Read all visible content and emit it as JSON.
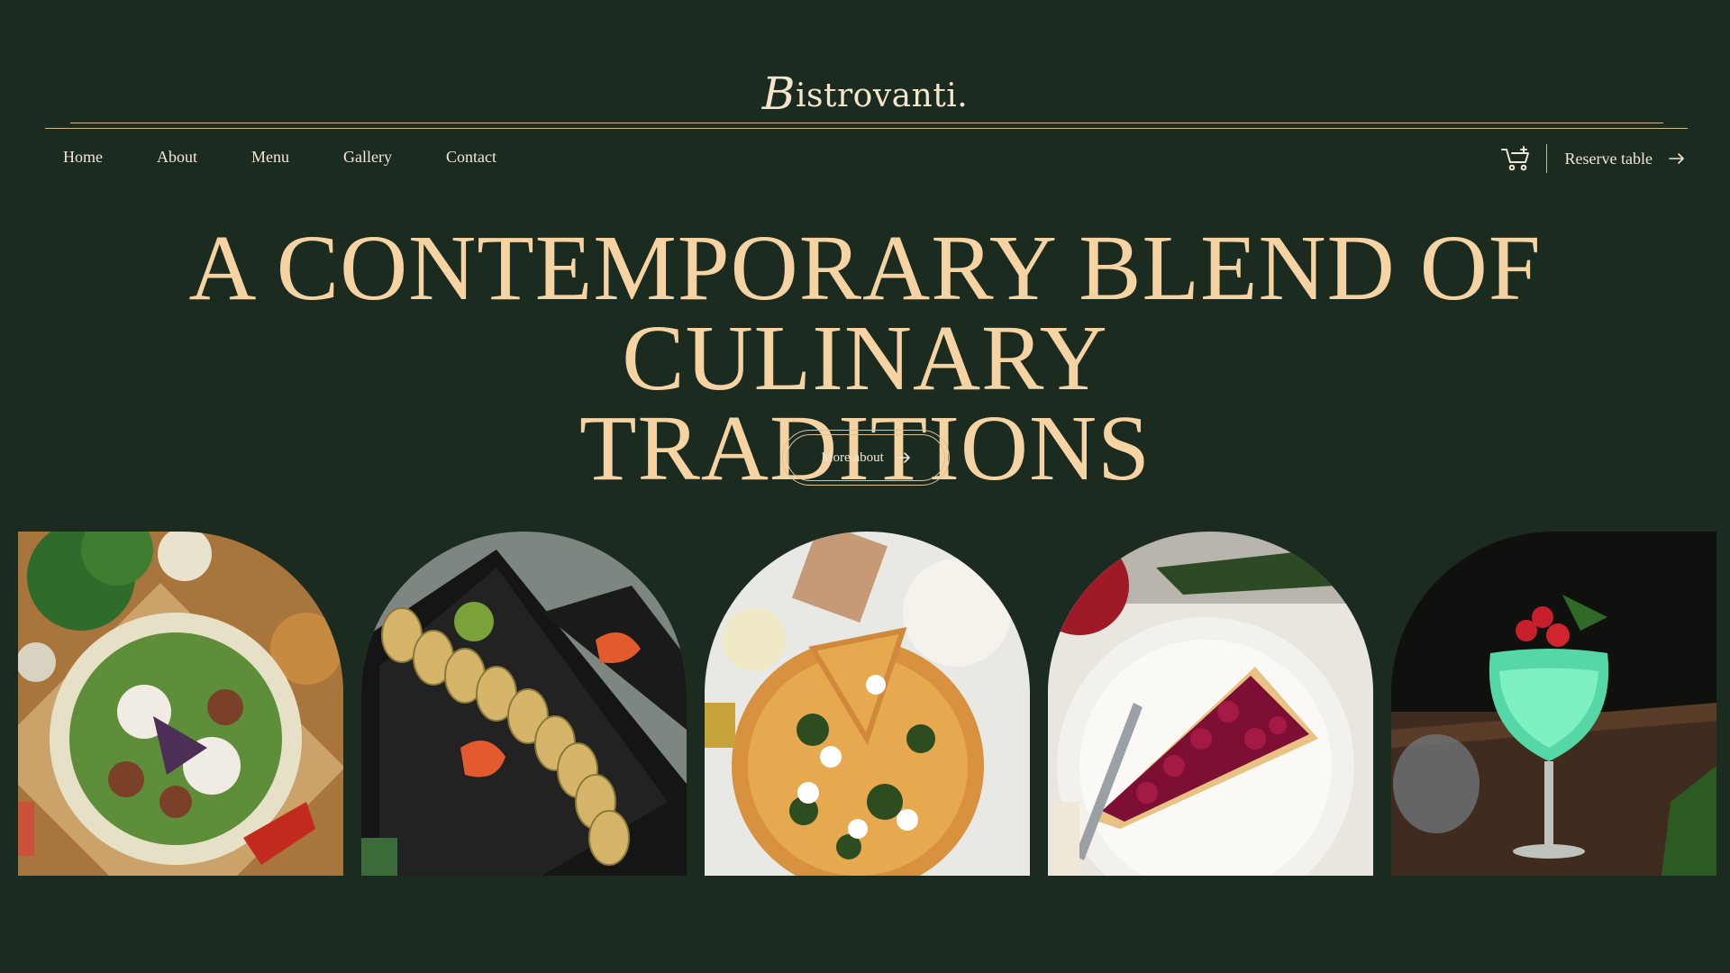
{
  "brand": {
    "initial": "B",
    "rest": "istrovanti."
  },
  "nav": {
    "items": [
      "Home",
      "About",
      "Menu",
      "Gallery",
      "Contact"
    ]
  },
  "header": {
    "reserve_label": "Reserve table",
    "cart_icon": "cart-icon"
  },
  "hero": {
    "line1": "A CONTEMPORARY BLEND OF CULINARY",
    "line2": "TRADITIONS",
    "button_label": "More about"
  },
  "colors": {
    "background": "#1b2b20",
    "accent": "#f6d3a2",
    "rule": "#cdb98e"
  },
  "gallery": [
    {
      "name": "falafel-salad"
    },
    {
      "name": "sushi-roll"
    },
    {
      "name": "pizza"
    },
    {
      "name": "cherry-tart"
    },
    {
      "name": "green-cocktail"
    }
  ]
}
